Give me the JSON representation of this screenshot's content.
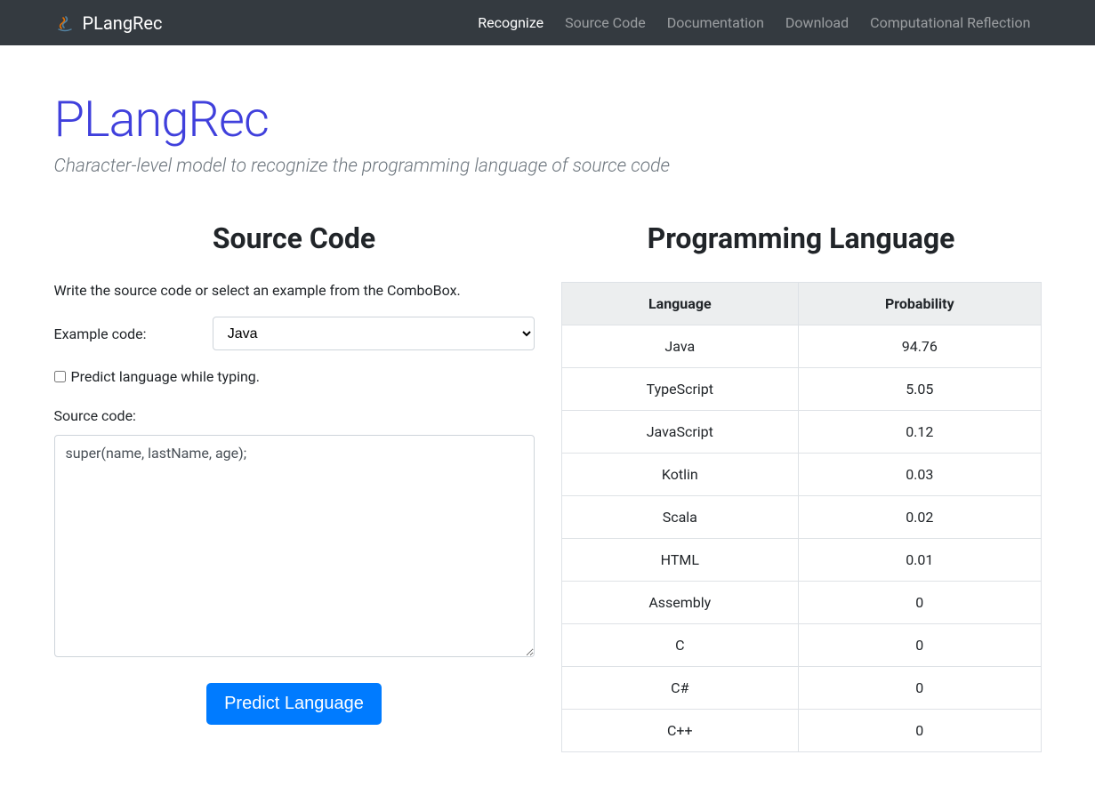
{
  "brand": "PLangRec",
  "nav": [
    {
      "label": "Recognize",
      "active": true
    },
    {
      "label": "Source Code",
      "active": false
    },
    {
      "label": "Documentation",
      "active": false
    },
    {
      "label": "Download",
      "active": false
    },
    {
      "label": "Computational Reflection",
      "active": false
    }
  ],
  "hero": {
    "title": "PLangRec",
    "subtitle": "Character-level model to recognize the programming language of source code"
  },
  "left": {
    "heading": "Source Code",
    "instruction": "Write the source code or select an example from the ComboBox.",
    "example_label": "Example code:",
    "example_selected": "Java",
    "checkbox_label": "Predict language while typing.",
    "source_label": "Source code:",
    "source_value": "super(name, lastName, age);",
    "predict_button": "Predict Language"
  },
  "right": {
    "heading": "Programming Language",
    "col_language": "Language",
    "col_probability": "Probability",
    "rows": [
      {
        "language": "Java",
        "probability": "94.76"
      },
      {
        "language": "TypeScript",
        "probability": "5.05"
      },
      {
        "language": "JavaScript",
        "probability": "0.12"
      },
      {
        "language": "Kotlin",
        "probability": "0.03"
      },
      {
        "language": "Scala",
        "probability": "0.02"
      },
      {
        "language": "HTML",
        "probability": "0.01"
      },
      {
        "language": "Assembly",
        "probability": "0"
      },
      {
        "language": "C",
        "probability": "0"
      },
      {
        "language": "C#",
        "probability": "0"
      },
      {
        "language": "C++",
        "probability": "0"
      }
    ]
  }
}
